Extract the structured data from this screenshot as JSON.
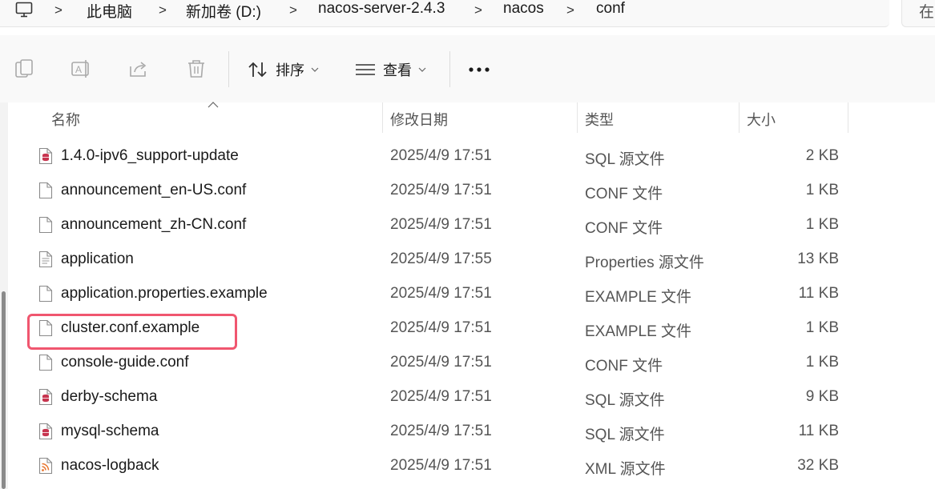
{
  "breadcrumb": {
    "root_icon": "computer-icon",
    "items": [
      "此电脑",
      "新加卷 (D:)",
      "nacos-server-2.4.3",
      "nacos",
      "conf"
    ],
    "separator": ">"
  },
  "search": {
    "partial_text": "在"
  },
  "toolbar": {
    "copy_icon": "copy-icon",
    "rename_icon": "rename-icon",
    "share_icon": "share-icon",
    "delete_icon": "delete-icon",
    "sort_label": "排序",
    "view_label": "查看",
    "more_icon": "more-icon"
  },
  "columns": {
    "name": "名称",
    "modified": "修改日期",
    "type": "类型",
    "size": "大小"
  },
  "files": [
    {
      "name": "1.4.0-ipv6_support-update",
      "modified": "2025/4/9 17:51",
      "type": "SQL 源文件",
      "size": "2 KB",
      "icon": "sql-file-icon"
    },
    {
      "name": "announcement_en-US.conf",
      "modified": "2025/4/9 17:51",
      "type": "CONF 文件",
      "size": "1 KB",
      "icon": "file-icon"
    },
    {
      "name": "announcement_zh-CN.conf",
      "modified": "2025/4/9 17:51",
      "type": "CONF 文件",
      "size": "1 KB",
      "icon": "file-icon"
    },
    {
      "name": "application",
      "modified": "2025/4/9 17:55",
      "type": "Properties 源文件",
      "size": "13 KB",
      "icon": "text-file-icon"
    },
    {
      "name": "application.properties.example",
      "modified": "2025/4/9 17:51",
      "type": "EXAMPLE 文件",
      "size": "11 KB",
      "icon": "file-icon"
    },
    {
      "name": "cluster.conf.example",
      "modified": "2025/4/9 17:51",
      "type": "EXAMPLE 文件",
      "size": "1 KB",
      "icon": "file-icon"
    },
    {
      "name": "console-guide.conf",
      "modified": "2025/4/9 17:51",
      "type": "CONF 文件",
      "size": "1 KB",
      "icon": "file-icon"
    },
    {
      "name": "derby-schema",
      "modified": "2025/4/9 17:51",
      "type": "SQL 源文件",
      "size": "9 KB",
      "icon": "sql-file-icon"
    },
    {
      "name": "mysql-schema",
      "modified": "2025/4/9 17:51",
      "type": "SQL 源文件",
      "size": "11 KB",
      "icon": "sql-file-icon"
    },
    {
      "name": "nacos-logback",
      "modified": "2025/4/9 17:51",
      "type": "XML 源文件",
      "size": "32 KB",
      "icon": "xml-file-icon"
    }
  ],
  "colors": {
    "highlight": "#f0566f",
    "sql_icon": "#c7354f",
    "xml_icon": "#e8742c"
  }
}
